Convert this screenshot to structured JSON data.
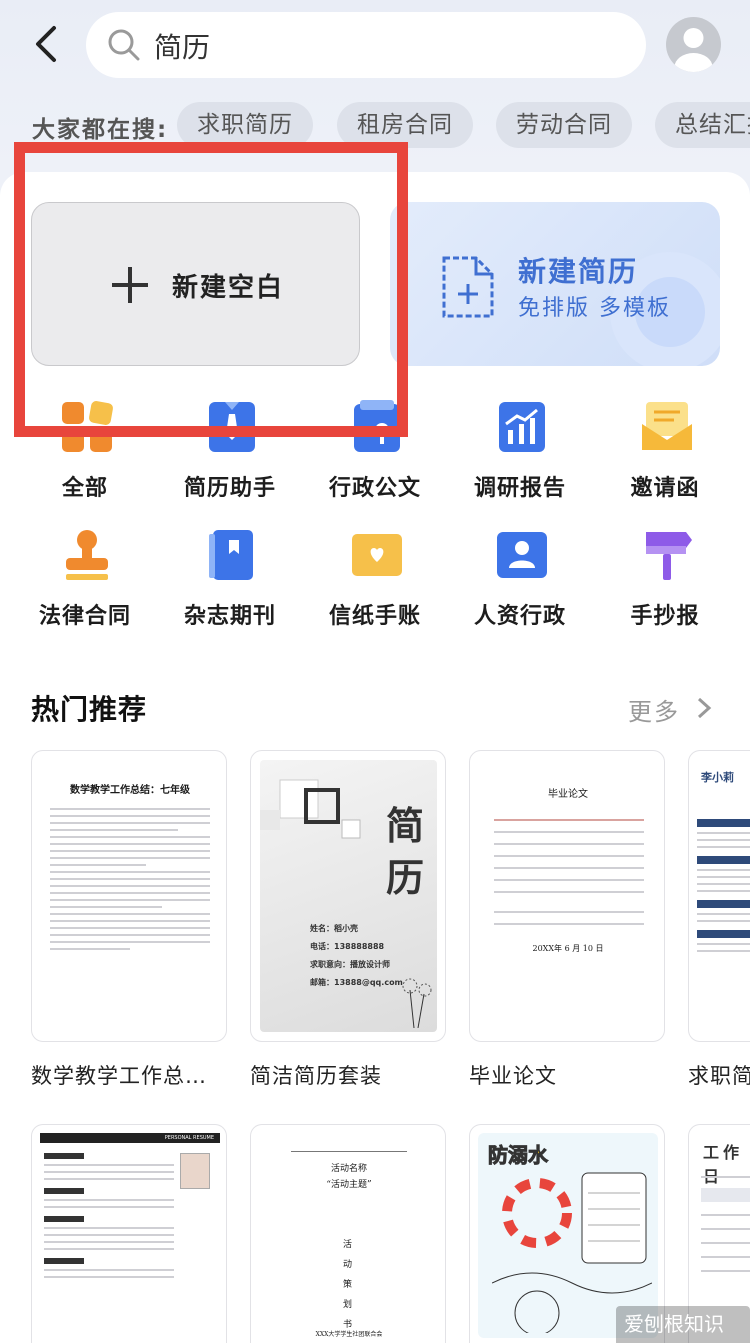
{
  "search": {
    "query": "简历"
  },
  "hot_searches": {
    "label": "大家都在搜:",
    "items": [
      "求职简历",
      "租房合同",
      "劳动合同",
      "总结汇报"
    ]
  },
  "new_blank": {
    "label": "新建空白"
  },
  "new_resume": {
    "title": "新建简历",
    "subtitle": "免排版 多模板"
  },
  "categories": [
    {
      "label": "全部",
      "icon": "grid-icon"
    },
    {
      "label": "简历助手",
      "icon": "resume-tie-icon"
    },
    {
      "label": "行政公文",
      "icon": "official-doc-icon"
    },
    {
      "label": "调研报告",
      "icon": "report-chart-icon"
    },
    {
      "label": "邀请函",
      "icon": "invitation-envelope-icon"
    },
    {
      "label": "法律合同",
      "icon": "stamp-icon"
    },
    {
      "label": "杂志期刊",
      "icon": "magazine-icon"
    },
    {
      "label": "信纸手账",
      "icon": "letter-icon"
    },
    {
      "label": "人资行政",
      "icon": "hr-person-icon"
    },
    {
      "label": "手抄报",
      "icon": "paint-brush-icon"
    }
  ],
  "hot": {
    "title": "热门推荐",
    "more": "更多"
  },
  "templates": [
    {
      "label": "数学教学工作总…",
      "heading": "数学教学工作总结：七年级"
    },
    {
      "label": "简洁简历套装",
      "heading": "简历",
      "fields": [
        "姓名：稻小壳",
        "电话：138888888",
        "求职意向：播放设计师",
        "邮箱：13888@qq.com"
      ]
    },
    {
      "label": "毕业论文",
      "heading": "毕业论文",
      "date": "20XX年 6 月 10 日"
    },
    {
      "label": "求职简历",
      "heading": "李小莉"
    },
    {
      "label": "",
      "heading": "PERSONAL RESUME"
    },
    {
      "label": "",
      "heading": "活动名称",
      "subheading": "“活动主题”",
      "vertical": "活动策划书",
      "footer": "XXX大学学生社团联合会"
    },
    {
      "label": "",
      "heading": "防溺水"
    },
    {
      "label": "",
      "heading": "工作日"
    }
  ],
  "watermark": "爱刨根知识网",
  "colors": {
    "accent_blue": "#3f6fd1",
    "highlight_red": "#e8453c"
  }
}
